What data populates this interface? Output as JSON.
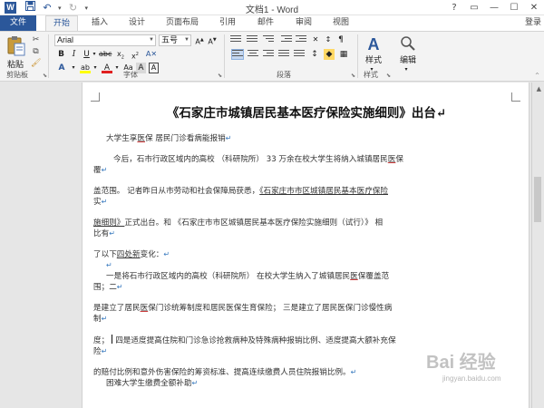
{
  "window": {
    "app_icon": "W",
    "title": "文档1 - Word",
    "controls": [
      "?",
      "▭",
      "—",
      "☐",
      "✕"
    ]
  },
  "quick_access": {
    "save_icon": "save-icon",
    "undo_icon": "undo-icon",
    "redo_icon": "redo-icon"
  },
  "tabs": {
    "file": "文件",
    "home": "开始",
    "insert": "插入",
    "design": "设计",
    "layout": "页面布局",
    "references": "引用",
    "mailings": "邮件",
    "review": "审阅",
    "view": "视图",
    "login": "登录"
  },
  "ribbon": {
    "paste_label": "粘贴",
    "clipboard_label": "剪贴板",
    "font_label": "字体",
    "paragraph_label": "段落",
    "styles_group_label": "样式",
    "font_name": "Arial",
    "font_size": "五号",
    "styles_label": "样式",
    "editing_label": "编辑",
    "accent_color": "#2b579a"
  },
  "document": {
    "heading": "《石家庄市城镇居民基本医疗保险实施细则》出台",
    "lines": [
      {
        "pre": "大学生享",
        "mark": "医",
        "post": "保 居民门诊看病能报销"
      },
      {
        "pre": "今后，石市行政区域内的高校 （科研院所） 33 万余在校大学生将纳入城镇居民",
        "mark": "医",
        "post": "保"
      },
      {
        "text": "覆"
      },
      {
        "pre": "盖范围。 记者昨日从市劳动和社会保障局获悉，",
        "link": "《石家庄市市区城镇居民基本医疗保险",
        "post": ""
      },
      {
        "text": "实"
      },
      {
        "pre": "",
        "link": "施细则》",
        "post": "正式出台。和 《石家庄市市区城镇居民基本医疗保险实施细则（试行）》 相"
      },
      {
        "text": "比有"
      },
      {
        "pre": "了以下",
        "link": "四处新",
        "post": "变化："
      },
      {
        "pre": "一是将石市行政区域内的高校（科研院所） 在校大学生纳入了城镇居民",
        "mark": "医",
        "post": "保覆盖范"
      },
      {
        "text": "围；二"
      },
      {
        "pre": "是建立了居民",
        "mark": "医",
        "post": "保门诊统筹制度和居民医保生育保险； 三是建立了居民医保门诊慢性病"
      },
      {
        "text": "制"
      },
      {
        "pre": "度；",
        "post": "四是适度提高住院和门诊急诊抢救病种及特殊病种报销比例、适度提高大额补充保"
      },
      {
        "text": "险"
      },
      {
        "pre": "的赔付比例和意外伤害保险的筹资标准、提高连续缴费人员住院报销比例。"
      },
      {
        "text": "困难大学生缴费全额补助"
      }
    ]
  },
  "watermark": {
    "logo": "Bai 经验",
    "url": "jingyan.baidu.com"
  }
}
